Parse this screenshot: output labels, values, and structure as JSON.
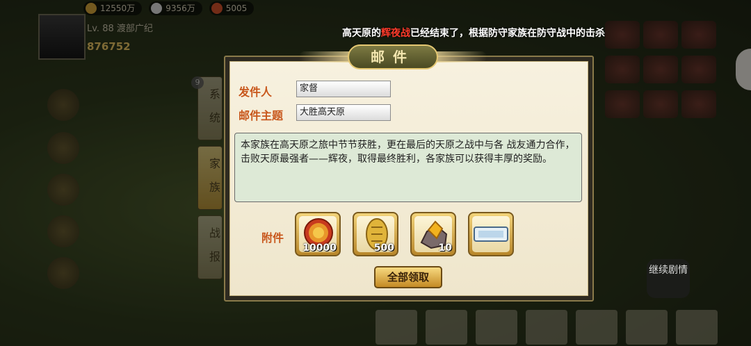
{
  "hud": {
    "resources": [
      {
        "value": "12550万",
        "icon": "gold-icon",
        "color": "#d2a23a"
      },
      {
        "value": "9356万",
        "icon": "rice-icon",
        "color": "#d9d9d9"
      },
      {
        "value": "5005",
        "icon": "gem-icon",
        "color": "#d0502a"
      }
    ],
    "level": "Lv. 88 渡部广纪",
    "power": "876752"
  },
  "announcement": {
    "prefix": "高天原的",
    "highlight": "辉夜战",
    "suffix": "已经结束了，根据防守家族在防守战中的击杀"
  },
  "side_tabs": {
    "system": "系统",
    "clan": "家族",
    "report": "战报",
    "badge": "9"
  },
  "continue_button": "继续剧情",
  "mail": {
    "title": "邮件",
    "sender_label": "发件人",
    "sender_value": "家督",
    "subject_label": "邮件主题",
    "subject_value": "大胜高天原",
    "body": "本家族在高天原之旅中节节获胜，更在最后的天原之战中与各 战友通力合作，击败天原最强者——辉夜，取得最终胜利，各家族可以获得丰厚的奖励。",
    "attachments_label": "附件",
    "attachments": [
      {
        "icon": "magatama-coin-icon",
        "qty": "10000"
      },
      {
        "icon": "gold-oval-coin-icon",
        "qty": "500"
      },
      {
        "icon": "ore-stone-icon",
        "qty": "10"
      },
      {
        "icon": "ticket-icon",
        "qty": ""
      }
    ],
    "claim_all": "全部领取"
  }
}
